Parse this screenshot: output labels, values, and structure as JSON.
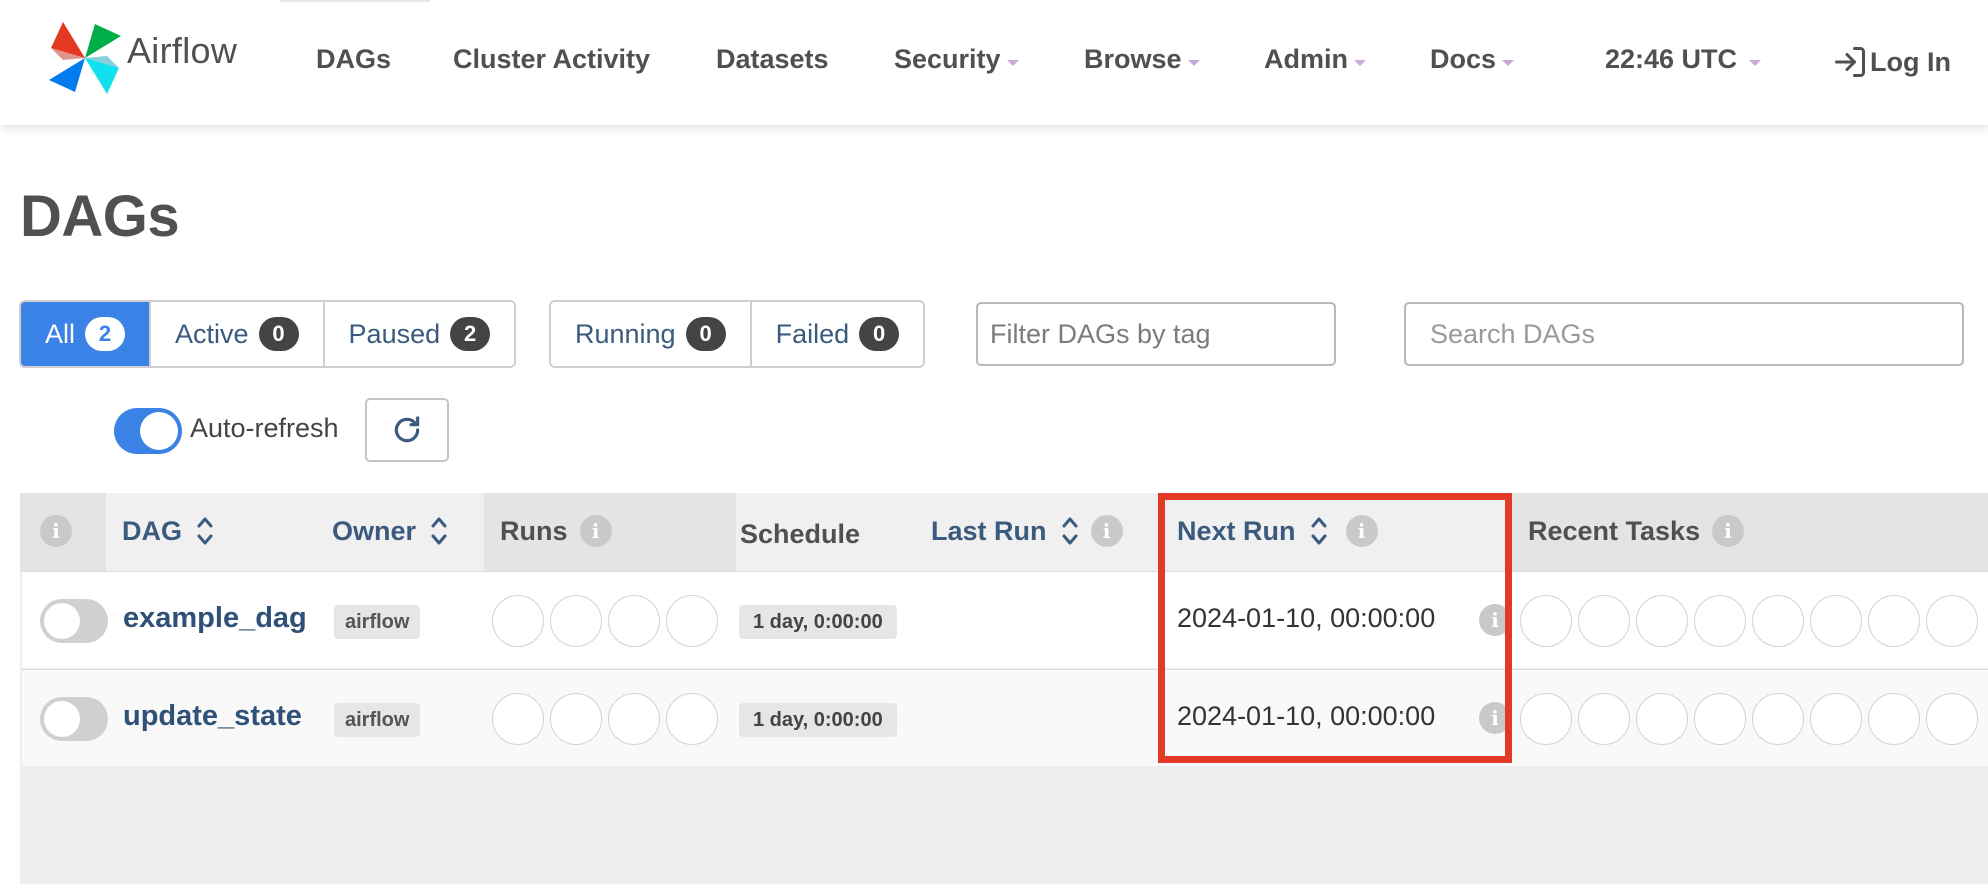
{
  "brand": {
    "name": "Airflow"
  },
  "nav": {
    "dags": "DAGs",
    "cluster_activity": "Cluster Activity",
    "datasets": "Datasets",
    "security": "Security",
    "browse": "Browse",
    "admin": "Admin",
    "docs": "Docs",
    "time": "22:46 UTC",
    "login": "Log In"
  },
  "page": {
    "title": "DAGs"
  },
  "status_filters": [
    {
      "label": "All",
      "count": "2",
      "active": true
    },
    {
      "label": "Active",
      "count": "0"
    },
    {
      "label": "Paused",
      "count": "2"
    }
  ],
  "run_filters": [
    {
      "label": "Running",
      "count": "0"
    },
    {
      "label": "Failed",
      "count": "0"
    }
  ],
  "filter_tag": {
    "placeholder": "Filter DAGs by tag"
  },
  "search": {
    "placeholder": "Search DAGs"
  },
  "auto_refresh": {
    "label": "Auto-refresh",
    "enabled": true
  },
  "table": {
    "columns": {
      "dag": "DAG",
      "owner": "Owner",
      "runs": "Runs",
      "schedule": "Schedule",
      "last_run": "Last Run",
      "next_run": "Next Run",
      "recent_tasks": "Recent Tasks"
    },
    "rows": [
      {
        "dag": "example_dag",
        "owner": "airflow",
        "schedule": "1 day, 0:00:00",
        "last_run": "",
        "next_run": "2024-01-10, 00:00:00",
        "paused": true
      },
      {
        "dag": "update_state",
        "owner": "airflow",
        "schedule": "1 day, 0:00:00",
        "last_run": "",
        "next_run": "2024-01-10, 00:00:00",
        "paused": true
      }
    ]
  },
  "colors": {
    "accent": "#3a82e6",
    "link": "#2f5177",
    "highlight": "#e23a26"
  }
}
